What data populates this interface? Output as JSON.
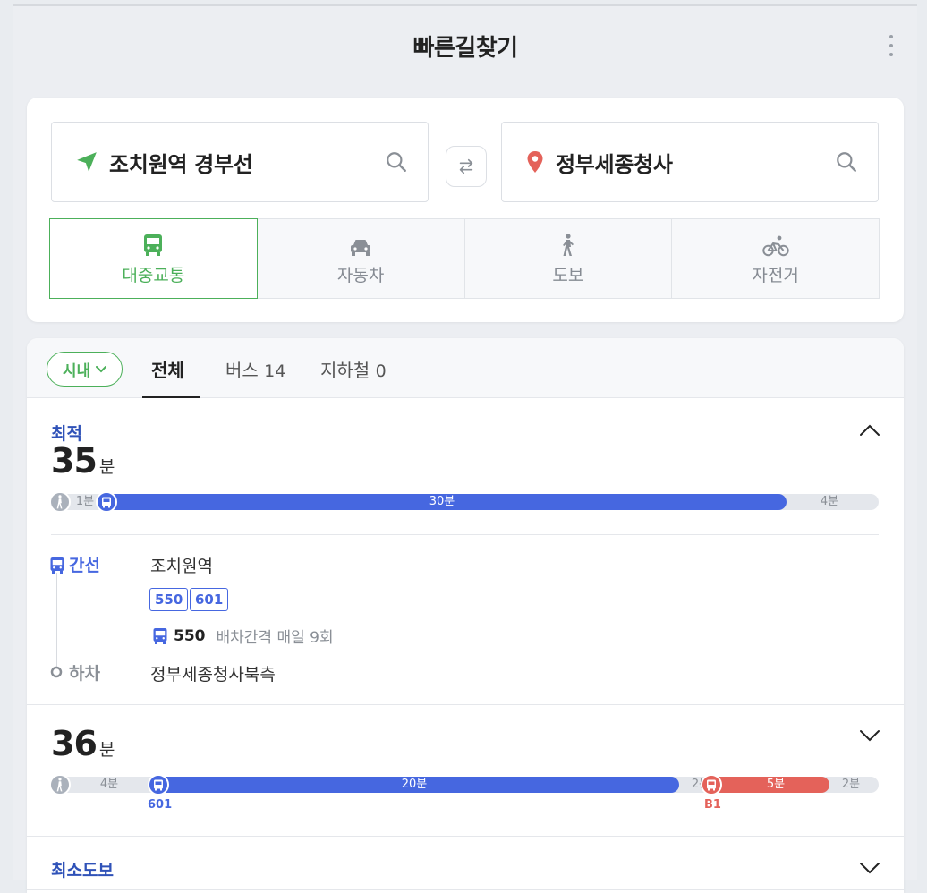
{
  "header": {
    "title": "빠른길찾기",
    "more_icon": "more-vertical-icon"
  },
  "search": {
    "from": {
      "value": "조치원역 경부선",
      "icon": "navigation-arrow-icon",
      "icon_color": "#4cb05a"
    },
    "to": {
      "value": "정부세종청사",
      "icon": "location-pin-icon",
      "icon_color": "#e4625a"
    },
    "swap_icon": "swap-arrows-icon"
  },
  "modes": [
    {
      "label": "대중교통",
      "icon": "bus-icon",
      "active": true
    },
    {
      "label": "자동차",
      "icon": "car-icon",
      "active": false
    },
    {
      "label": "도보",
      "icon": "walk-icon",
      "active": false
    },
    {
      "label": "자전거",
      "icon": "bicycle-icon",
      "active": false
    }
  ],
  "filter": {
    "scope": "시내",
    "tabs": [
      {
        "label": "전체",
        "count": "",
        "active": true
      },
      {
        "label": "버스",
        "count": "14",
        "active": false
      },
      {
        "label": "지하철",
        "count": "0",
        "active": false
      }
    ]
  },
  "routes": [
    {
      "tag": "최적",
      "duration": "35",
      "unit": "분",
      "expanded": true,
      "bar": [
        {
          "type": "walk",
          "label": "1분"
        },
        {
          "type": "bus",
          "label": "30분"
        },
        {
          "type": "walk",
          "label": "4분"
        }
      ],
      "steps": {
        "board_label": "간선",
        "board_stop": "조치원역",
        "bus_numbers": [
          "550",
          "601"
        ],
        "interval_bus": "550",
        "interval_text": "배차간격 매일 9회",
        "alight_label": "하차",
        "alight_stop": "정부세종청사북측"
      }
    },
    {
      "tag": "",
      "duration": "36",
      "unit": "분",
      "expanded": false,
      "bar": [
        {
          "type": "walk",
          "label": "4분"
        },
        {
          "type": "bus",
          "label": "20분",
          "line": "601"
        },
        {
          "type": "walk",
          "label": "2분"
        },
        {
          "type": "bus-red",
          "label": "5분",
          "line": "B1"
        },
        {
          "type": "walk",
          "label": "2분"
        }
      ]
    },
    {
      "tag": "최소도보",
      "expanded": false
    }
  ],
  "colors": {
    "accent_green": "#4cb05a",
    "bus_blue": "#4667e0",
    "brt_red": "#e4625a",
    "tag_blue": "#2f52b8"
  }
}
